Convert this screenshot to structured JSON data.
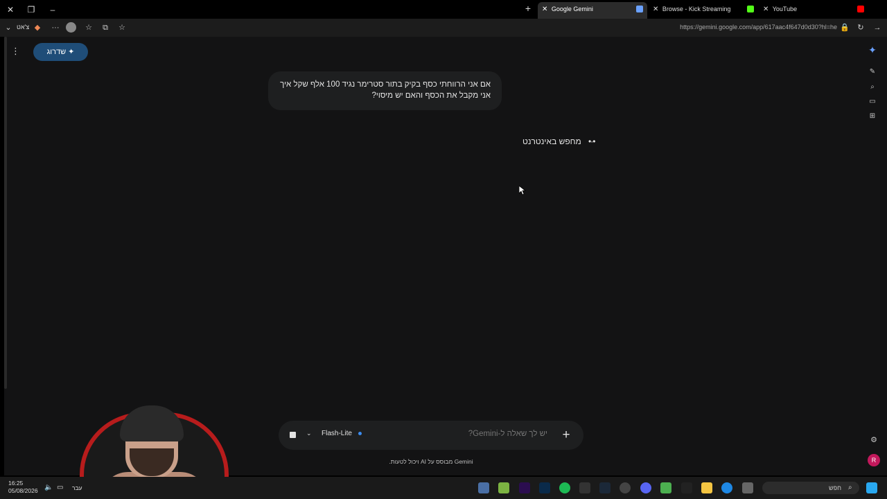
{
  "browser": {
    "tabs": [
      {
        "label": "Google Gemini",
        "active": true,
        "favicon_color": "#6aa1ff"
      },
      {
        "label": "Browse - Kick Streaming",
        "active": false,
        "favicon_color": "#53fc18"
      },
      {
        "label": "YouTube",
        "active": false,
        "favicon_color": "#ff0000"
      }
    ],
    "url": "https://gemini.google.com/app/617aac4f647d0d30?hl=he",
    "chat_label": "צ'אט"
  },
  "gemini": {
    "upgrade_label": "שדרוג",
    "user_message": "אם אני הרווחתי כסף בקיק בתור סטרימר נגיד 100 אלף שקל איך אני מקבל את הכסף והאם יש מיסוי?",
    "status_text": "מחפש באינטרנט",
    "input_placeholder": "יש לך שאלה ל-Gemini?",
    "model_name": "Flash-Lite",
    "disclaimer": "Gemini מבוסס על AI ויכול לטעות.",
    "avatar_letter": "R",
    "accent": "#1f4d78"
  },
  "taskbar": {
    "time": "16:25",
    "date": "05/08/2026",
    "language": "עבר",
    "search_label": "חפש"
  }
}
